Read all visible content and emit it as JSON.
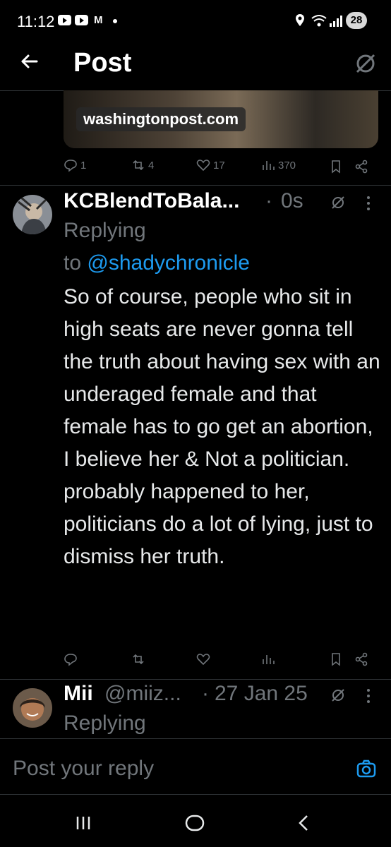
{
  "status": {
    "time": "11:12",
    "m_icon": "M",
    "battery": "28"
  },
  "header": {
    "title": "Post"
  },
  "card": {
    "domain": "washingtonpost.com"
  },
  "actions_main": {
    "replies": "1",
    "reposts": "4",
    "likes": "17",
    "views": "370"
  },
  "reply1": {
    "name": "KCBlendToBala...",
    "sep": "·",
    "time": "0s",
    "replying_label": "Replying",
    "to_label": "to",
    "mention": "@shadychronicle",
    "text": "So of course, people who sit in high seats are never gonna tell the truth about having sex with an underaged female and that female has to go get an abortion, I believe her & Not a politician.  probably happened to her, politicians do a lot of lying, just to dismiss her truth."
  },
  "reply2": {
    "name": "Mii",
    "handle": "@miiz...",
    "sep": "·",
    "time": "27 Jan 25",
    "replying_label": "Replying"
  },
  "composer": {
    "placeholder": "Post your reply"
  },
  "icons": {
    "back": "arrow-left-icon",
    "grok": "grok-icon",
    "reply": "reply-icon",
    "repost": "repost-icon",
    "like": "heart-icon",
    "views": "views-icon",
    "bookmark": "bookmark-icon",
    "share": "share-icon",
    "more": "more-icon",
    "camera": "camera-icon",
    "nav_recent": "recent-apps-icon",
    "nav_home": "home-icon",
    "nav_back": "back-icon"
  },
  "colors": {
    "background": "#000000",
    "text": "#e7e9ea",
    "muted": "#71767b",
    "accent": "#1d9bf0",
    "divider": "#2f3336"
  }
}
